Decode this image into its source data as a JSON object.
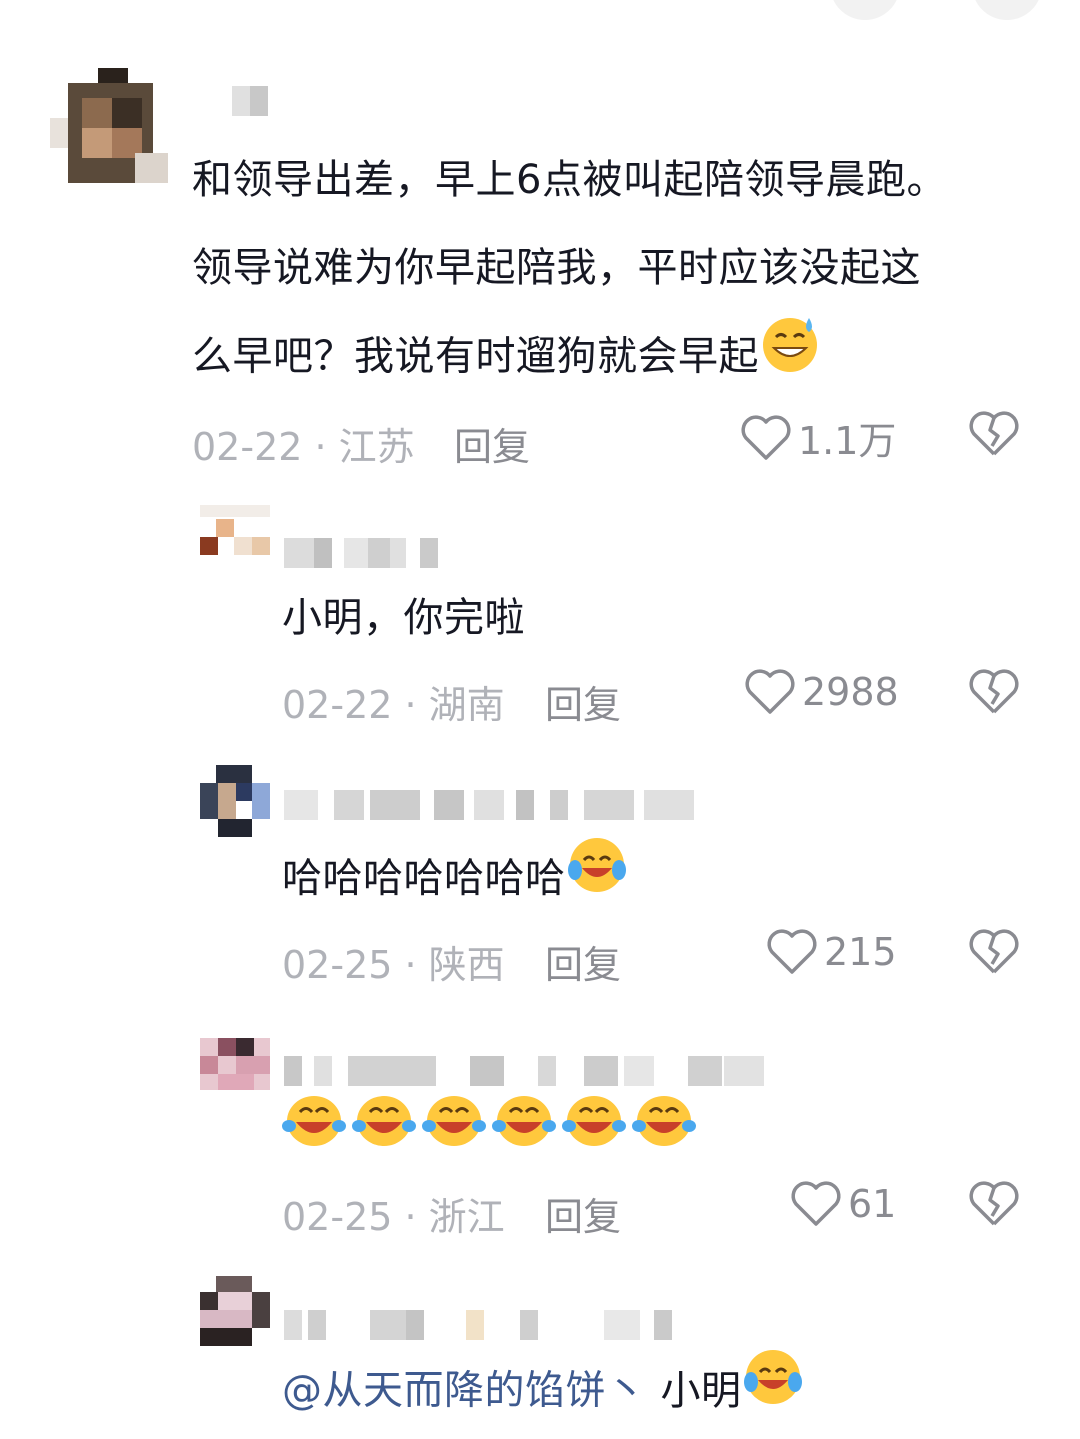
{
  "top_buttons": [
    "back",
    "more"
  ],
  "comments": [
    {
      "text_lines": [
        "和领导出差，早上6点被叫起陪领导晨跑。",
        "领导说难为你早起陪我，平时应该没起这",
        "么早吧？我说有时遛狗就会早起"
      ],
      "emoji": "sweat-grin-emoji",
      "meta": "02-22 · 江苏",
      "reply_label": "回复",
      "likes": "1.1万"
    }
  ],
  "replies": [
    {
      "text": "小明，你完啦",
      "meta": "02-22 · 湖南",
      "reply_label": "回复",
      "likes": "2988"
    },
    {
      "text": "哈哈哈哈哈哈哈",
      "emoji": "tears-of-joy-emoji",
      "meta": "02-25 · 陕西",
      "reply_label": "回复",
      "likes": "215"
    },
    {
      "text": "",
      "emoji_count": 6,
      "emoji": "laughing-tears-emoji",
      "meta": "02-25 · 浙江",
      "reply_label": "回复",
      "likes": "61"
    },
    {
      "mention": "@从天而降的馅饼丶",
      "text": "小明",
      "emoji": "tears-of-joy-emoji"
    }
  ],
  "colors": {
    "text": "#161823",
    "meta": "#b0b2b8",
    "icon": "#8a8b91",
    "mention": "#3e5a8f",
    "emoji_yellow": "#ffc83d"
  }
}
